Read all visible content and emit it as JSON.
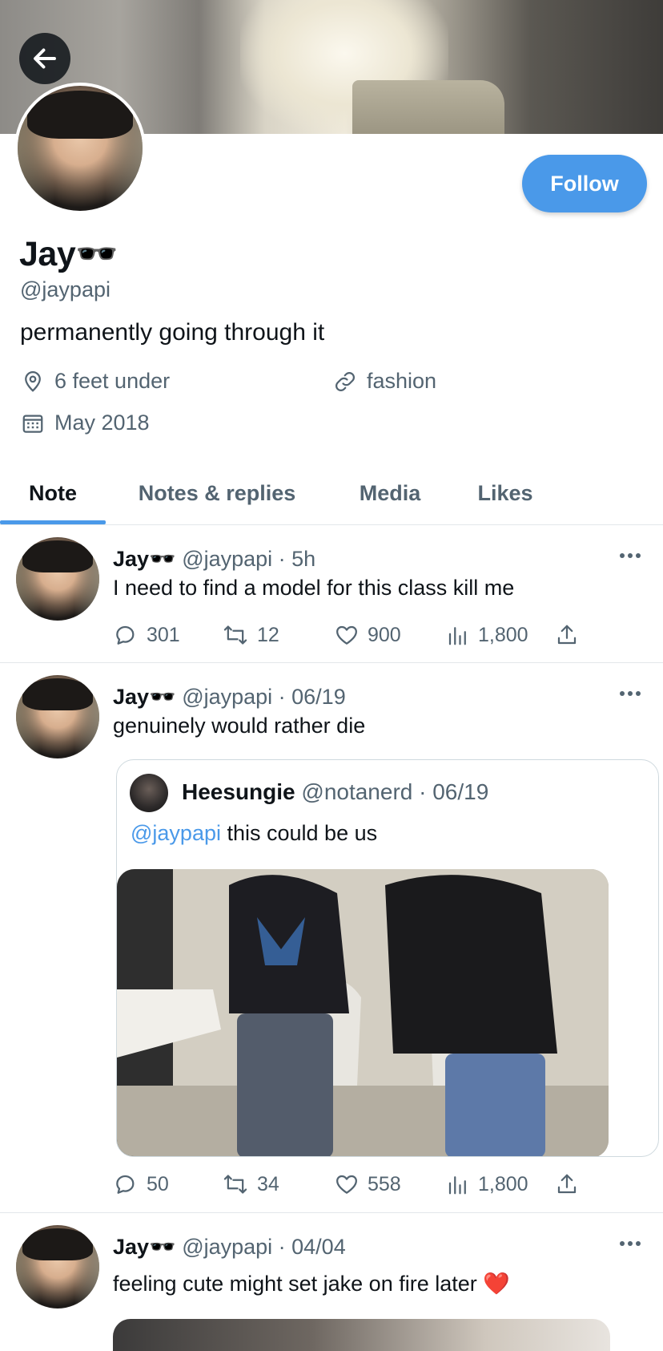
{
  "profile": {
    "display_name": "Jay🕶️",
    "handle": "@jaypapi",
    "bio": "permanently going through it",
    "location": "6 feet under",
    "website": "fashion",
    "joined": "May 2018",
    "follow_label": "Follow"
  },
  "tabs": [
    {
      "label": "Note",
      "active": true
    },
    {
      "label": "Notes & replies",
      "active": false
    },
    {
      "label": "Media",
      "active": false
    },
    {
      "label": "Likes",
      "active": false
    }
  ],
  "tweets": [
    {
      "name": "Jay🕶️",
      "meta": "@jaypapi · 5h",
      "text": "I need to find a model for this class kill me",
      "replies": "301",
      "retweets": "12",
      "likes": "900",
      "views": "1,800"
    },
    {
      "name": "Jay🕶️",
      "meta": "@jaypapi · 06/19",
      "text": "genuinely would rather die",
      "quote": {
        "name": "Heesungie",
        "meta": "@notanerd · 06/19",
        "mention": "@jaypapi",
        "text": " this could be us"
      },
      "replies": "50",
      "retweets": "34",
      "likes": "558",
      "views": "1,800"
    },
    {
      "name": "Jay🕶️",
      "meta": "@jaypapi · 04/04",
      "text": "feeling cute might set jake on fire later ❤️"
    }
  ],
  "colors": {
    "accent": "#4a99e9",
    "secondary_text": "#536471",
    "primary_text": "#0f1419",
    "divider": "#e3e7ea"
  },
  "icons": [
    "back-arrow-icon",
    "location-pin-icon",
    "link-icon",
    "calendar-icon",
    "more-icon",
    "reply-icon",
    "retweet-icon",
    "like-icon",
    "views-icon",
    "share-icon"
  ]
}
